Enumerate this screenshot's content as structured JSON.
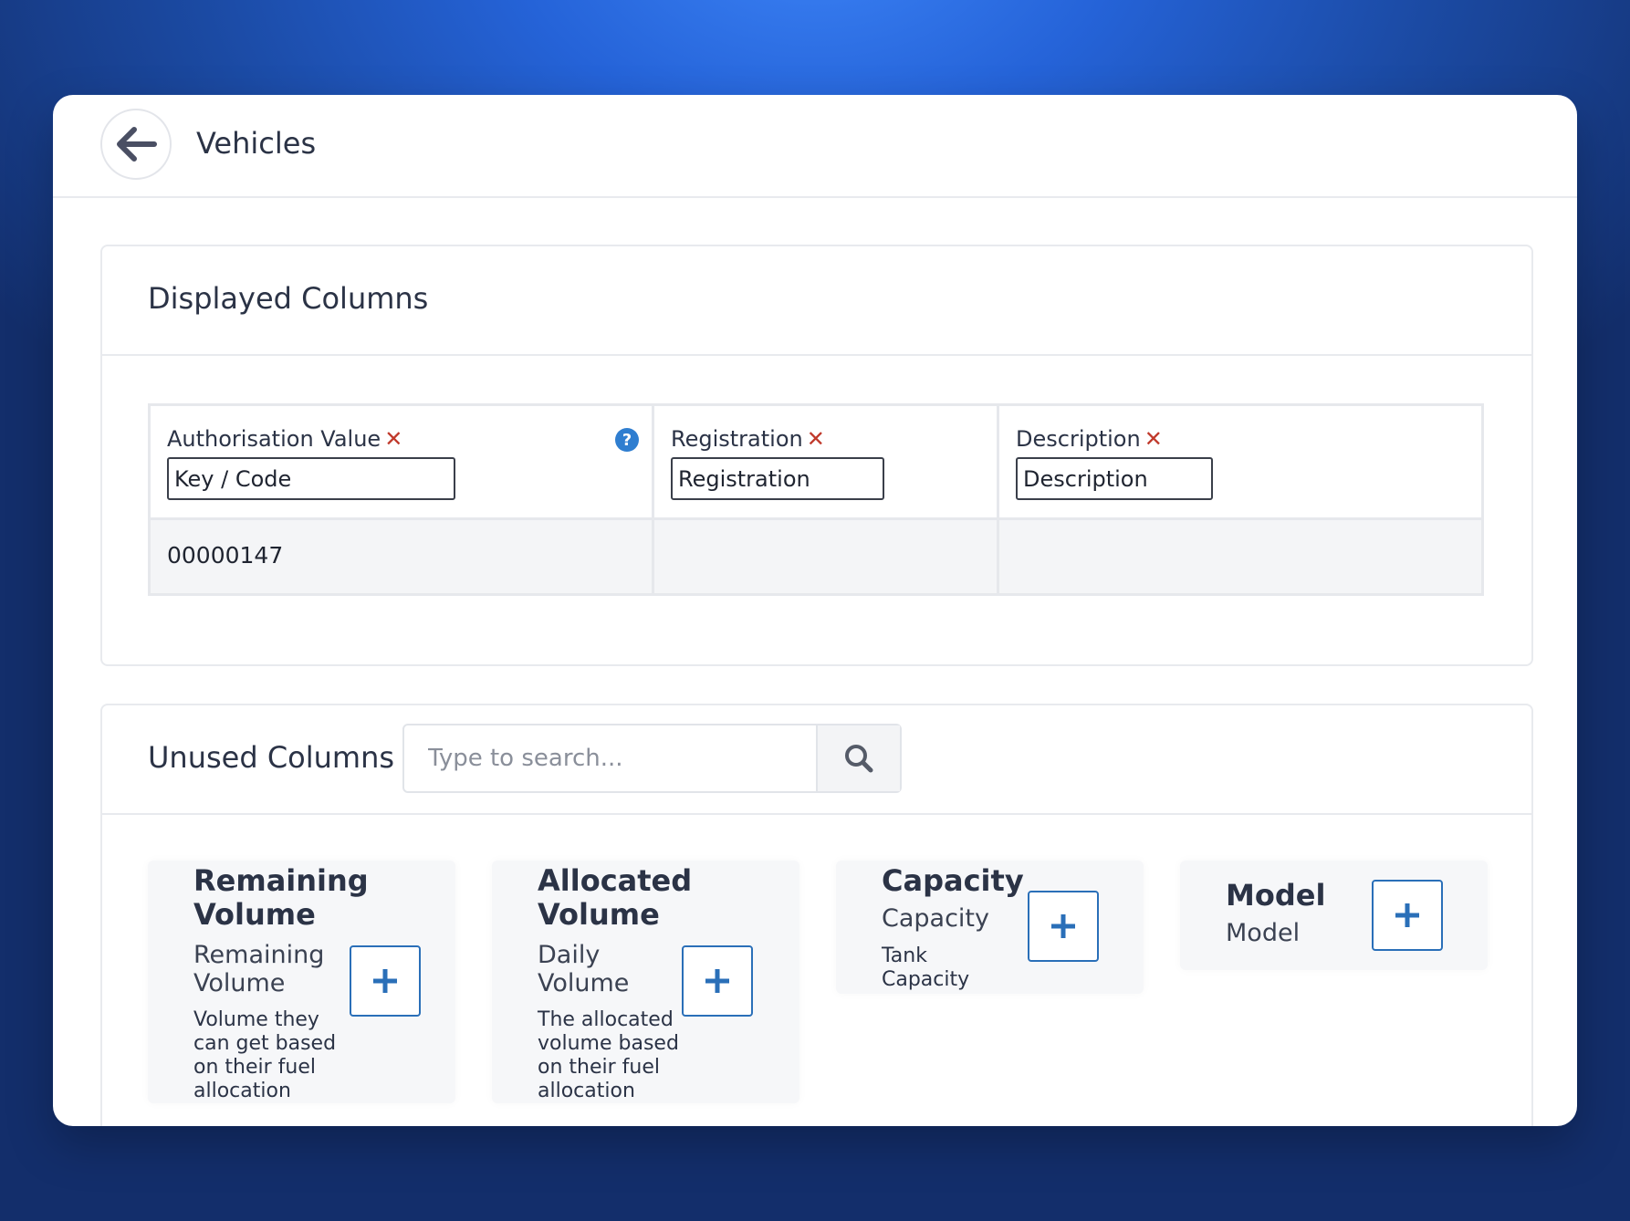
{
  "header": {
    "title": "Vehicles"
  },
  "displayed": {
    "title": "Displayed Columns",
    "columns": [
      {
        "label": "Authorisation Value",
        "input_value": "Key / Code",
        "value": "00000147"
      },
      {
        "label": "Registration",
        "input_value": "Registration",
        "value": ""
      },
      {
        "label": "Description",
        "input_value": "Description",
        "value": ""
      }
    ]
  },
  "unused": {
    "title": "Unused Columns",
    "search_placeholder": "Type to search...",
    "cards": [
      {
        "title_lines": [
          "Remaining",
          "Volume"
        ],
        "sub_lines": [
          "Remaining",
          "Volume"
        ],
        "desc_lines": [
          "Volume they",
          "can get based",
          "on their fuel",
          "allocation"
        ]
      },
      {
        "title_lines": [
          "Allocated",
          "Volume"
        ],
        "sub_lines": [
          "Daily",
          "Volume"
        ],
        "desc_lines": [
          "The allocated",
          "volume based",
          "on their fuel",
          "allocation"
        ]
      },
      {
        "title_lines": [
          "Capacity"
        ],
        "sub_lines": [
          "Capacity"
        ],
        "desc_lines": [
          "Tank",
          "Capacity"
        ]
      },
      {
        "title_lines": [
          "Model"
        ],
        "sub_lines": [
          "Model"
        ],
        "desc_lines": []
      }
    ]
  },
  "colors": {
    "accent": "#2f7ed0",
    "remove": "#c0392b",
    "button_border": "#2a6fb8"
  }
}
